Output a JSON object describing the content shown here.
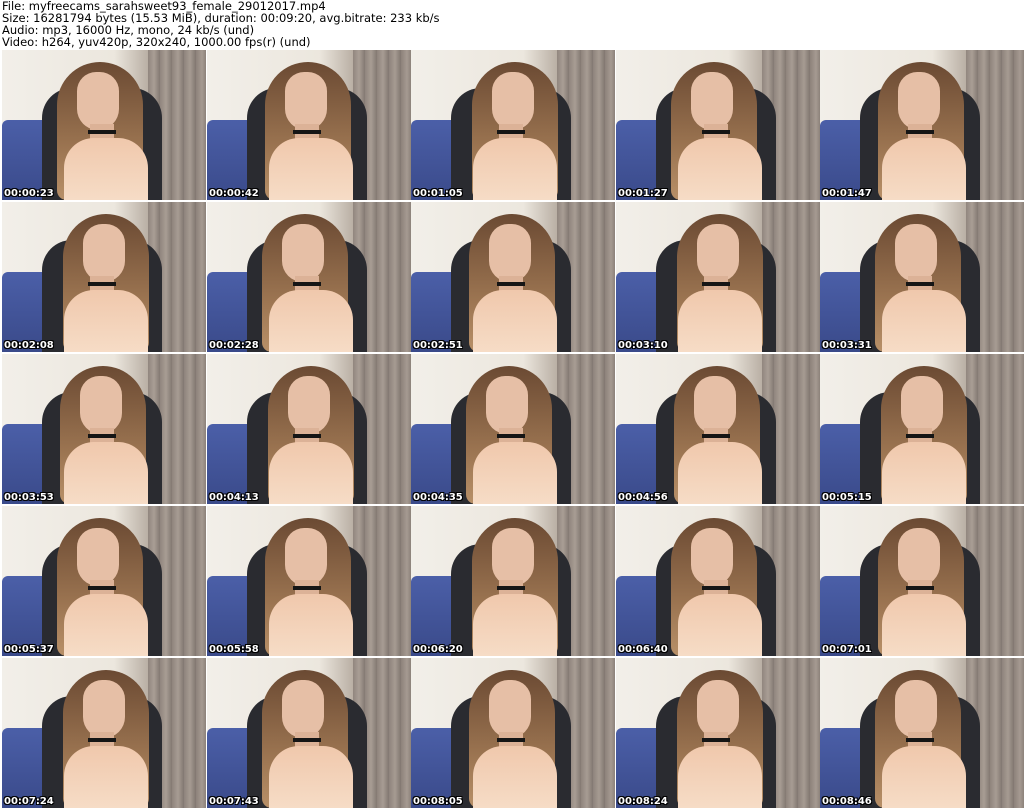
{
  "header": {
    "file_line": "File: myfreecams_sarahsweet93_female_29012017.mp4",
    "size_line": "Size: 16281794 bytes (15.53 MiB), duration: 00:09:20, avg.bitrate: 233 kb/s",
    "audio_line": "Audio: mp3, 16000 Hz, mono, 24 kb/s (und)",
    "video_line": "Video: h264, yuv420p, 320x240, 1000.00 fps(r) (und)"
  },
  "thumbnails": [
    {
      "timestamp": "00:00:23"
    },
    {
      "timestamp": "00:00:42"
    },
    {
      "timestamp": "00:01:05"
    },
    {
      "timestamp": "00:01:27"
    },
    {
      "timestamp": "00:01:47"
    },
    {
      "timestamp": "00:02:08"
    },
    {
      "timestamp": "00:02:28"
    },
    {
      "timestamp": "00:02:51"
    },
    {
      "timestamp": "00:03:10"
    },
    {
      "timestamp": "00:03:31"
    },
    {
      "timestamp": "00:03:53"
    },
    {
      "timestamp": "00:04:13"
    },
    {
      "timestamp": "00:04:35"
    },
    {
      "timestamp": "00:04:56"
    },
    {
      "timestamp": "00:05:15"
    },
    {
      "timestamp": "00:05:37"
    },
    {
      "timestamp": "00:05:58"
    },
    {
      "timestamp": "00:06:20"
    },
    {
      "timestamp": "00:06:40"
    },
    {
      "timestamp": "00:07:01"
    },
    {
      "timestamp": "00:07:24"
    },
    {
      "timestamp": "00:07:43"
    },
    {
      "timestamp": "00:08:05"
    },
    {
      "timestamp": "00:08:24"
    },
    {
      "timestamp": "00:08:46"
    }
  ]
}
